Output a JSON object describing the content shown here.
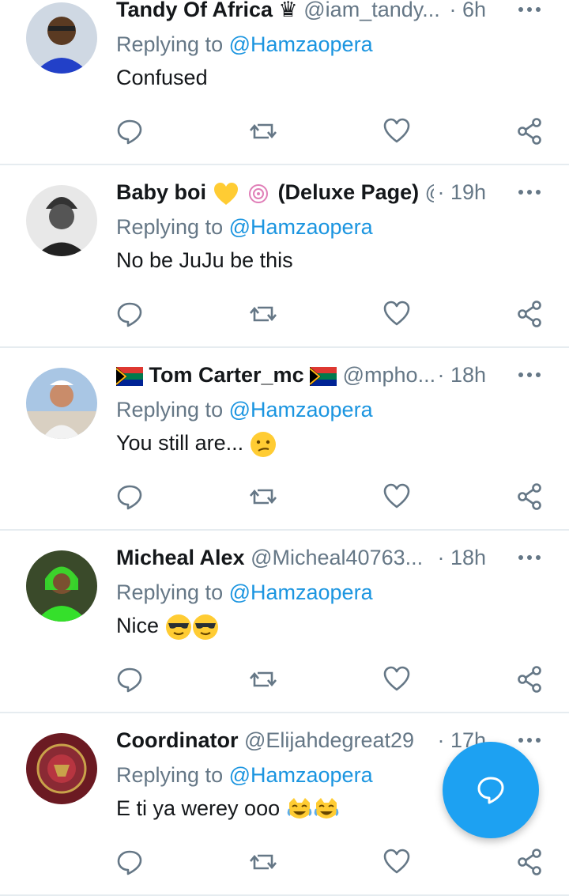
{
  "tweets": [
    {
      "name": "Tandy Of Africa ♛",
      "handle": "@iam_tandy...",
      "time": "· 6h",
      "reply_prefix": "Replying to ",
      "reply_to": "@Hamzaopera",
      "text": "Confused"
    },
    {
      "name": "Baby boi",
      "name_suffix": "(Deluxe Page)",
      "handle": "@",
      "time": "· 19h",
      "reply_prefix": "Replying to ",
      "reply_to": "@Hamzaopera",
      "text": "No be JuJu be this"
    },
    {
      "name": "Tom Carter_mc",
      "handle": "@mpho...",
      "time": "· 18h",
      "reply_prefix": "Replying to ",
      "reply_to": "@Hamzaopera",
      "text": "You still are..."
    },
    {
      "name": "Micheal Alex",
      "handle": "@Micheal40763...",
      "time": "· 18h",
      "reply_prefix": "Replying to ",
      "reply_to": "@Hamzaopera",
      "text": "Nice"
    },
    {
      "name": "Coordinator",
      "handle": "@Elijahdegreat29",
      "time": "· 17h",
      "reply_prefix": "Replying to ",
      "reply_to": "@Hamzaopera",
      "text": "E ti ya werey ooo"
    }
  ],
  "icons": {
    "reply": "reply-icon",
    "retweet": "retweet-icon",
    "like": "heart-icon",
    "share": "share-icon",
    "more": "more-options-icon",
    "compose": "compose-reply-icon"
  },
  "colors": {
    "accent": "#1da1f2",
    "mention": "#1b95e0",
    "muted": "#657786"
  }
}
